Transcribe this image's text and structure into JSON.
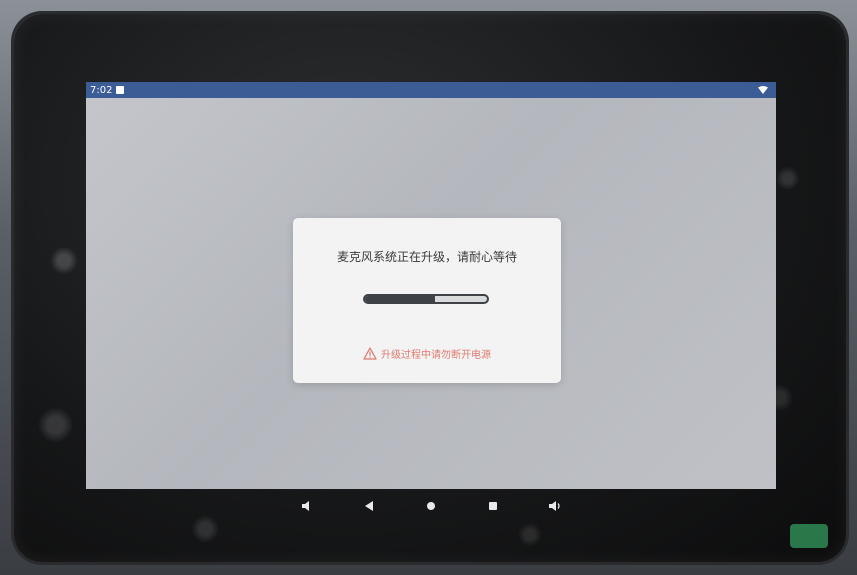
{
  "status_bar": {
    "time": "7:02",
    "icons": [
      "notification-icon",
      "wifi-icon"
    ],
    "color": "#3b5c95"
  },
  "dialog": {
    "message": "麦克风系统正在升级，请耐心等待",
    "progress": 0.57,
    "warning_icon": "warning-triangle-icon",
    "warning": "升级过程中请勿断开电源",
    "warning_color": "#e07a6e"
  },
  "nav_bar": {
    "buttons": [
      "volume-down-icon",
      "back-icon",
      "home-icon",
      "recents-icon",
      "volume-up-icon"
    ]
  }
}
